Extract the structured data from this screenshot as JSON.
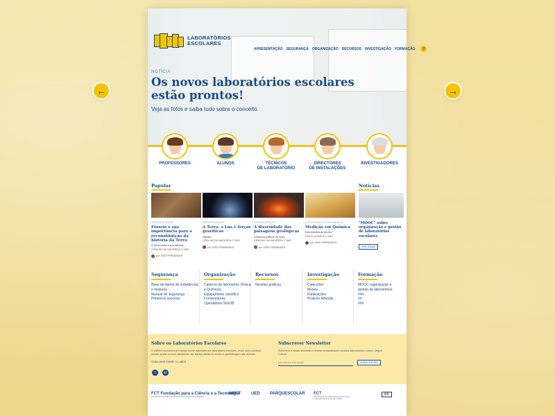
{
  "logo": {
    "mark": "LABES",
    "line1": "LABORATÓRIOS",
    "line2": "ESCOLARES"
  },
  "nav": [
    "APRESENTAÇÃO",
    "SEGURANÇA",
    "ORGANIZAÇÃO",
    "RECURSOS",
    "INVESTIGAÇÃO",
    "FORMAÇÃO"
  ],
  "hero": {
    "kicker": "NOTÍCIA",
    "headline_1": "Os novos laboratórios escolares",
    "headline_2": "estão prontos!",
    "subhead": "Veja as fotos e saiba tudo sobre o conceito."
  },
  "personas": [
    {
      "label_1": "PROFESSORES",
      "label_2": "",
      "hair": "#6b3a1c",
      "body": "#ffffff"
    },
    {
      "label_1": "ALUNOS",
      "label_2": "",
      "hair": "#5a3a28",
      "body": "#2f7ad1"
    },
    {
      "label_1": "TÉCNICOS",
      "label_2": "DE LABORATÓRIO",
      "hair": "#b5692d",
      "body": "#ffffff"
    },
    {
      "label_1": "DIRECTORES",
      "label_2": "DE INSTALAÇÕES",
      "hair": "#8a6a52",
      "body": "#ffffff"
    },
    {
      "label_1": "INVESTIGADORES",
      "label_2": "",
      "hair": "#dcdcdc",
      "body": "#ffffff"
    }
  ],
  "popular": {
    "title": "Popular",
    "cards": [
      {
        "cat": "APRESENTAÇÃO",
        "title": "Fósseis e sua importância para a reconstituição da história da Terra",
        "desc": "A Terra conta a sua história",
        "tag": "CIÊNCIAS DA NATUREZA 7º ANO",
        "author": "por JOÃO FERNANDES",
        "thumb": "linear-gradient(135deg,#6b4a2e,#a07a52 45%,#5a3a22)"
      },
      {
        "cat": "APRESENTAÇÃO",
        "title": "A Terra, a Lua e forças gravíticas",
        "desc": "Espaço",
        "tag": "CIÊNCIAS DA NATUREZA 7º ANO",
        "author": "por JOÃO FERNANDES",
        "thumb": "radial-gradient(circle at 55% 70%,#7fa0c8,#2a3e5e 35%,#0b0f18 60%)"
      },
      {
        "cat": "APRESENTAÇÃO",
        "title": "A diversidade das paisagens geológicas",
        "desc": "Dinâmica externa da Terra",
        "tag": "CIÊNCIAS DA NATUREZA 7º ANO",
        "author": "por JOÃO FERNANDES",
        "thumb": "radial-gradient(ellipse at 50% 65%,#ff8a2a,#b33a10 30%,#3a2a26 65%)"
      },
      {
        "cat": "ACTIVIDADE EXPERIMENTAL",
        "title": "Medição em Química",
        "desc": "Das estrelas ao átomo",
        "tag": "FÍSICO-QUÍMICA 7º ANO",
        "author": "por JOÃO FERNANDES",
        "thumb": "linear-gradient(160deg,#efe1b0,#d7a24a 55%,#a87030)"
      }
    ]
  },
  "news": {
    "title": "Notícias",
    "item_title": "\"MOOC\" sobre organização e gestão de laboratórios escolares",
    "button": "VER TODAS"
  },
  "columns": [
    {
      "title": "Segurança",
      "links": [
        "Base de dados de substâncias e misturas",
        "Manual de segurança",
        "Primeiros socorros"
      ]
    },
    {
      "title": "Organização",
      "links": [
        "Caderno de laboratório (Física e Química)",
        "Equipamento científico",
        "Fornecedores",
        "Operadores SIGOB"
      ]
    },
    {
      "title": "Recursos",
      "links": [
        "Novelas gráficas"
      ]
    },
    {
      "title": "Investigação",
      "links": [
        "Colecções",
        "Museu",
        "Publicações",
        "Projecto Alfaúdis..."
      ]
    },
    {
      "title": "Formação",
      "links": [
        "MOOC organização e gestão de laboratórios",
        "###",
        "##",
        "###"
      ]
    }
  ],
  "footer": {
    "about_title": "Sobre os Laboratórios Escolares",
    "about_text": "O LABES consolidou um espaço online associado aos laboratórios escolares, tendo como principal missão apoiar os seus utilizadores nas tarefas diárias de ensino e aprendizagem das ciências.",
    "about_link": "SAIBA MAIS SOBRE O LABES",
    "newsletter_title": "Subscrever Newsletter",
    "newsletter_text": "Subscreva a nossa newsletter e receba semanalmente recursos educacionais, cursos, artigos e livros.",
    "newsletter_placeholder": "Introduza o seu email",
    "newsletter_button": "SUBSCREVER"
  },
  "partners": [
    {
      "name": "FCT Fundação para a Ciência e a Tecnologia",
      "sub": "MINISTÉRIO DA CIÊNCIA, TECNOLOGIA E ENSINO SUPERIOR"
    },
    {
      "name": "idFCT",
      "sub": ""
    },
    {
      "name": "UED",
      "sub": ""
    },
    {
      "name": "PARQUESCOLAR",
      "sub": ""
    },
    {
      "name": "FCT",
      "sub": "FACULDADE DE CIÊNCIAS E TECNOLOGIA UNIVERSIDADE NOVA DE LISBOA"
    },
    {
      "name": "cc",
      "sub": ""
    }
  ],
  "colors": {
    "accent": "#f5c400",
    "brand": "#1a4a8a"
  }
}
